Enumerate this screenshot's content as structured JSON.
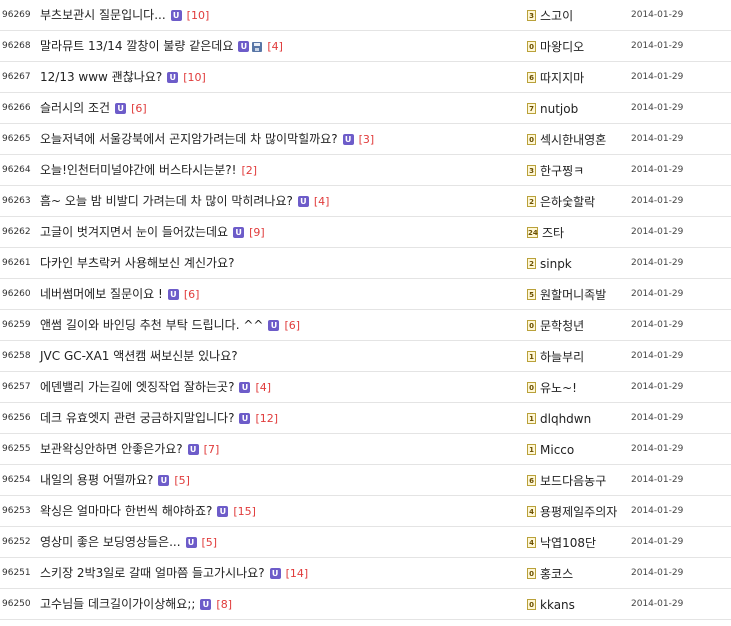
{
  "posts": [
    {
      "num": "96269",
      "title": "부츠보관시 질문입니다...",
      "u": "U",
      "disk": false,
      "count": "[10]",
      "level": "3",
      "author": "스고이",
      "date": "2014-01-29"
    },
    {
      "num": "96268",
      "title": "말라뮤트 13/14 깔창이 불량 같은데요",
      "u": "U",
      "disk": true,
      "count": "[4]",
      "level": "0",
      "author": "마왕디오",
      "date": "2014-01-29"
    },
    {
      "num": "96267",
      "title": "12/13 www 괜찮나요?",
      "u": "U",
      "disk": false,
      "count": "[10]",
      "level": "6",
      "author": "따지지마",
      "date": "2014-01-29"
    },
    {
      "num": "96266",
      "title": "슬러시의 조건",
      "u": "U",
      "disk": false,
      "count": "[6]",
      "level": "7",
      "author": "nutjob",
      "date": "2014-01-29"
    },
    {
      "num": "96265",
      "title": "오늘저녁에 서울강북에서 곤지암가려는데 차 많이막힐까요?",
      "u": "U",
      "disk": false,
      "count": "[3]",
      "level": "0",
      "author": "섹시한내영혼",
      "date": "2014-01-29"
    },
    {
      "num": "96264",
      "title": "오늘!인천터미널야간에 버스타시는분?!",
      "u": "",
      "disk": false,
      "count": "[2]",
      "level": "3",
      "author": "한구찡ㅋ",
      "date": "2014-01-29"
    },
    {
      "num": "96263",
      "title": "흠~ 오늘 밤 비발디 가려는데 차 많이 막히려나요?",
      "u": "U",
      "disk": false,
      "count": "[4]",
      "level": "2",
      "author": "은하숯할락",
      "date": "2014-01-29"
    },
    {
      "num": "96262",
      "title": "고글이 벗겨지면서 눈이 들어갔는데요",
      "u": "U",
      "disk": false,
      "count": "[9]",
      "level": "24",
      "author": "즈타",
      "date": "2014-01-29"
    },
    {
      "num": "96261",
      "title": "다카인 부츠락커 사용해보신 계신가요?",
      "u": "",
      "disk": false,
      "count": "",
      "level": "2",
      "author": "sinpk",
      "date": "2014-01-29"
    },
    {
      "num": "96260",
      "title": "네버썸머에보 질문이요 !",
      "u": "U",
      "disk": false,
      "count": "[6]",
      "level": "5",
      "author": "원할머니족발",
      "date": "2014-01-29"
    },
    {
      "num": "96259",
      "title": "앤썸 길이와 바인딩 추천 부탁 드립니다. ^^",
      "u": "U",
      "disk": false,
      "count": "[6]",
      "level": "0",
      "author": "문학청년",
      "date": "2014-01-29"
    },
    {
      "num": "96258",
      "title": "JVC GC-XA1 액션캠 써보신분 있나요?",
      "u": "",
      "disk": false,
      "count": "",
      "level": "1",
      "author": "하늘부리",
      "date": "2014-01-29"
    },
    {
      "num": "96257",
      "title": "에덴밸리 가는길에 엣징작업 잘하는곳?",
      "u": "U",
      "disk": false,
      "count": "[4]",
      "level": "0",
      "author": "유노~!",
      "date": "2014-01-29"
    },
    {
      "num": "96256",
      "title": "데크 유효엣지 관련 궁금하지말입니다?",
      "u": "U",
      "disk": false,
      "count": "[12]",
      "level": "1",
      "author": "dlqhdwn",
      "date": "2014-01-29"
    },
    {
      "num": "96255",
      "title": "보관왁싱안하면 안좋은가요?",
      "u": "U",
      "disk": false,
      "count": "[7]",
      "level": "1",
      "author": "Micco",
      "date": "2014-01-29"
    },
    {
      "num": "96254",
      "title": "내일의 용평 어떨까요?",
      "u": "U",
      "disk": false,
      "count": "[5]",
      "level": "6",
      "author": "보드다음농구",
      "date": "2014-01-29"
    },
    {
      "num": "96253",
      "title": "왁싱은 얼마마다 한번씩 해야하죠?",
      "u": "U",
      "disk": false,
      "count": "[15]",
      "level": "4",
      "author": "용평제일주의자",
      "date": "2014-01-29"
    },
    {
      "num": "96252",
      "title": "영상미 좋은 보딩영상들은...",
      "u": "U",
      "disk": false,
      "count": "[5]",
      "level": "4",
      "author": "낙엽108단",
      "date": "2014-01-29"
    },
    {
      "num": "96251",
      "title": "스키장 2박3일로 갈때 얼마쯤 들고가시나요?",
      "u": "U",
      "disk": false,
      "count": "[14]",
      "level": "0",
      "author": "홍코스",
      "date": "2014-01-29"
    },
    {
      "num": "96250",
      "title": "고수님들 데크길이가이상해요;;",
      "u": "U",
      "disk": false,
      "count": "[8]",
      "level": "0",
      "author": "kkans",
      "date": "2014-01-29"
    }
  ]
}
